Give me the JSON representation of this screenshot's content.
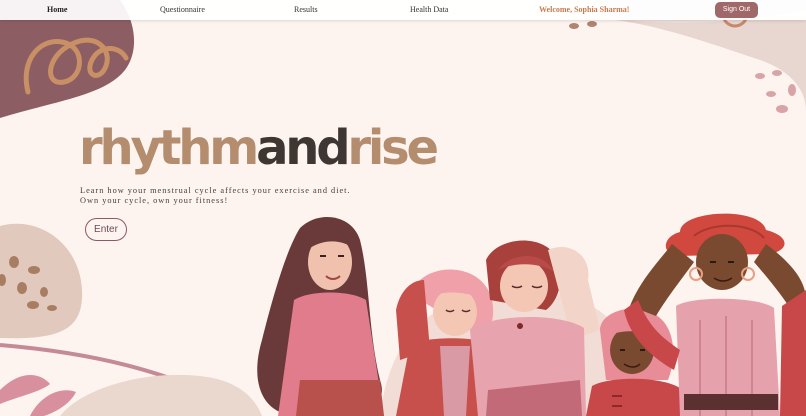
{
  "nav": {
    "home": "Home",
    "questionnaire": "Questionnaire",
    "results": "Results",
    "health_data": "Health Data",
    "welcome": "Welcome, Sophia Sharma!",
    "sign_out": "Sign Out"
  },
  "hero": {
    "title_word_1": "rhythm",
    "title_word_2": "and",
    "title_word_3": "rise",
    "subtitle_line_1": "Learn how your menstrual cycle affects your exercise and diet.",
    "subtitle_line_2": "Own your cycle, own your fitness!",
    "enter_label": "Enter"
  },
  "colors": {
    "background": "#fdf4f0",
    "title_accent": "#b48c6e",
    "title_dark": "#3d3632",
    "welcome_text": "#c87a4e",
    "sign_out_button": "#a06868",
    "blob_mauve": "#8c5e63"
  },
  "illustration": {
    "subject": "group-of-women-illustration"
  }
}
